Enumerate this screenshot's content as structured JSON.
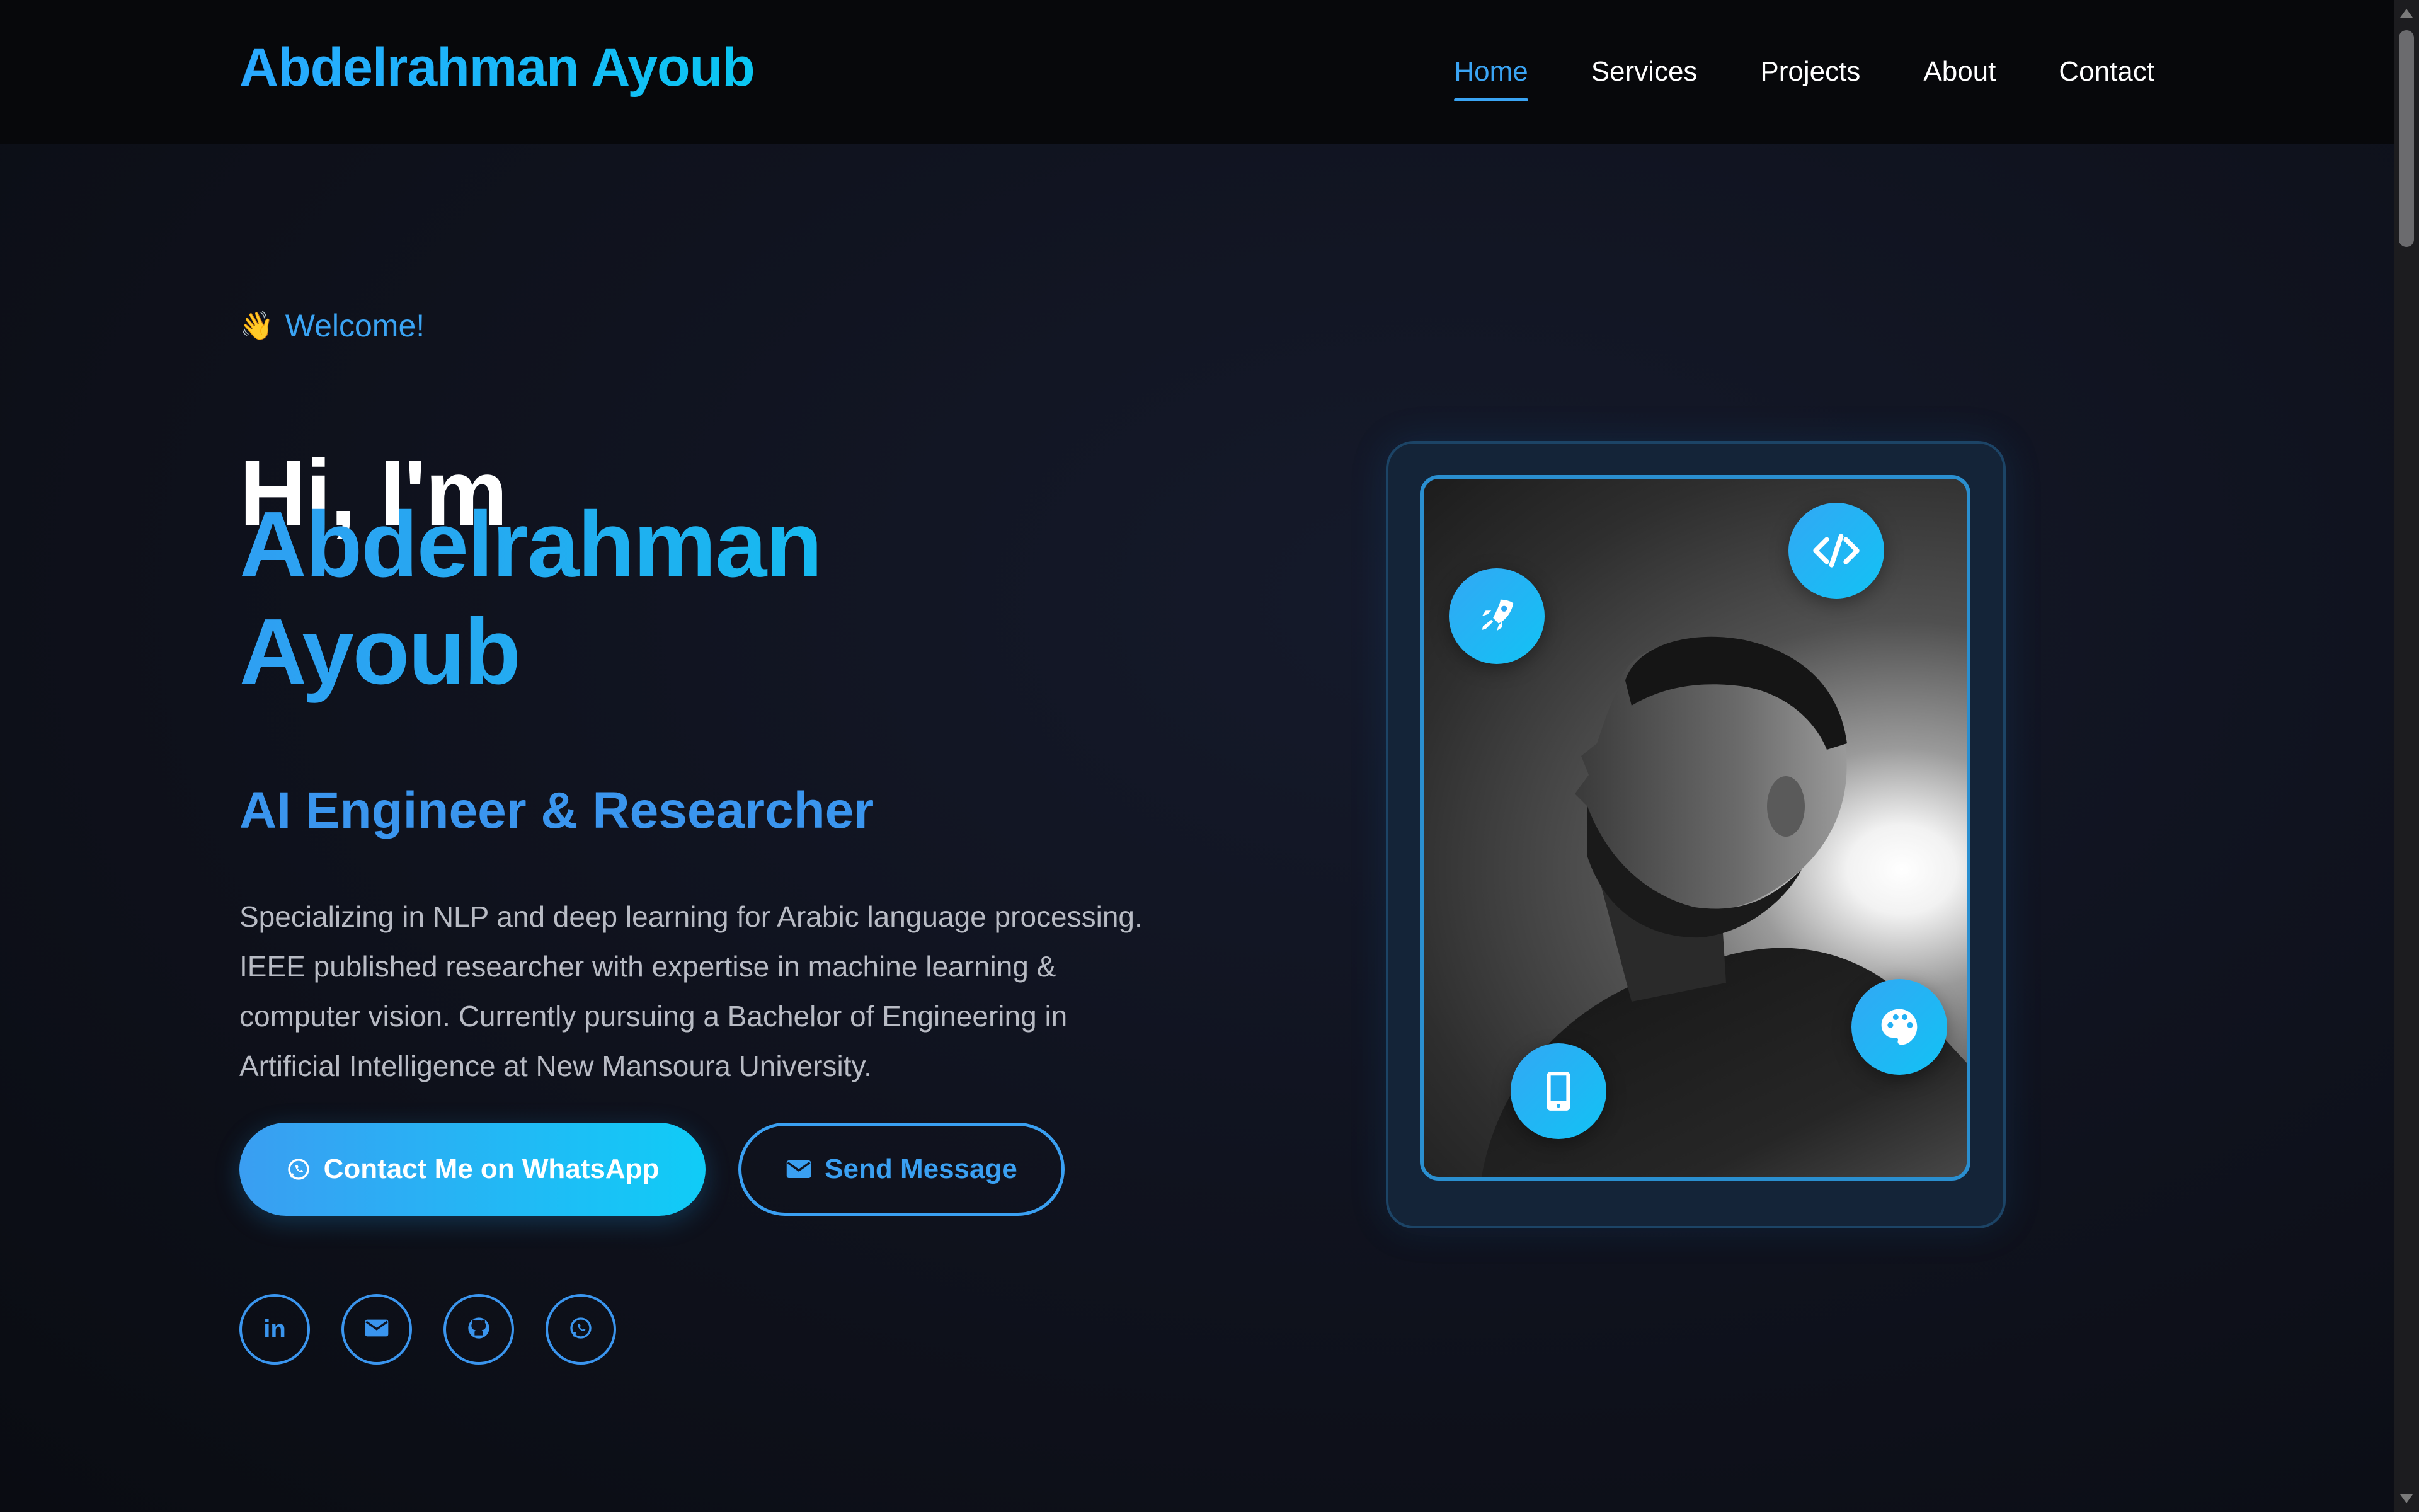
{
  "brand": {
    "name": "Abdelrahman Ayoub"
  },
  "nav": {
    "items": [
      {
        "label": "Home",
        "active": true
      },
      {
        "label": "Services",
        "active": false
      },
      {
        "label": "Projects",
        "active": false
      },
      {
        "label": "About",
        "active": false
      },
      {
        "label": "Contact",
        "active": false
      }
    ]
  },
  "hero": {
    "welcome": "Welcome!",
    "wave_icon": "waving-hand-emoji",
    "greeting": "Hi, I'm",
    "name_line1": "Abdelrahman",
    "name_line2": "Ayoub",
    "role": "AI Engineer & Researcher",
    "description": "Specializing in NLP and deep learning for Arabic language processing. IEEE published researcher with expertise in machine learning & computer vision. Currently pursuing a Bachelor of Engineering in Artificial Intelligence at New Mansoura University.",
    "primary_button": {
      "label": "Contact Me on WhatsApp",
      "icon": "whatsapp-icon"
    },
    "secondary_button": {
      "label": "Send Message",
      "icon": "envelope-icon"
    },
    "social": [
      {
        "name": "linkedin",
        "icon": "linkedin-icon"
      },
      {
        "name": "email",
        "icon": "envelope-icon"
      },
      {
        "name": "github",
        "icon": "github-icon"
      },
      {
        "name": "whatsapp",
        "icon": "whatsapp-icon"
      }
    ]
  },
  "profile_card": {
    "image": "portrait-photo",
    "badges": [
      "rocket-icon",
      "code-icon",
      "palette-icon",
      "mobile-icon"
    ]
  },
  "colors": {
    "accent": "#3aa4f4",
    "accent_cyan": "#0fc6f2",
    "background": "#10131f",
    "navbar": "#07080b",
    "text_muted": "#b8bbc4"
  }
}
